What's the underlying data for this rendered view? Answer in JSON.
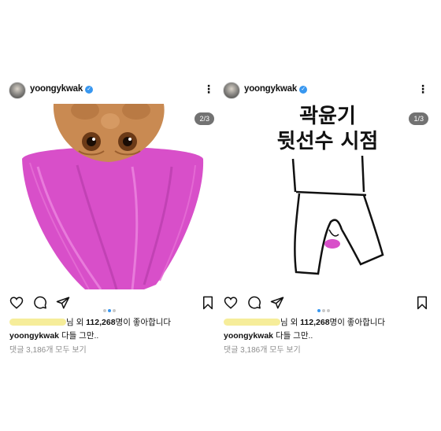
{
  "posts": [
    {
      "username": "yoongykwak",
      "counter": "2/3",
      "likes_prefix": "님 외 ",
      "likes_count": "112,268",
      "likes_suffix": "명이 좋아합니다",
      "caption_user": "yoongykwak",
      "caption_text": " 다들 그만..",
      "comments_link": "댓글 3,186개 모두 보기",
      "active_dot": 2
    },
    {
      "username": "yoongykwak",
      "counter": "1/3",
      "likes_prefix": "님 외 ",
      "likes_count": "112,268",
      "likes_suffix": "명이 좋아합니다",
      "caption_user": "yoongykwak",
      "caption_text": " 다들 그만..",
      "comments_link": "댓글 3,186개 모두 보기",
      "drawing_text_line1": "곽윤기",
      "drawing_text_line2": "뒷선수 시점",
      "active_dot": 1
    }
  ],
  "icons": {
    "like": "heart-icon",
    "comment": "comment-icon",
    "share": "send-icon",
    "save": "bookmark-icon",
    "more": "more-icon",
    "verified": "verified-badge-icon"
  },
  "colors": {
    "verified_blue": "#3897f0",
    "troll_hair": "#d84fc9",
    "highlight_blur": "#f6ed9a"
  }
}
